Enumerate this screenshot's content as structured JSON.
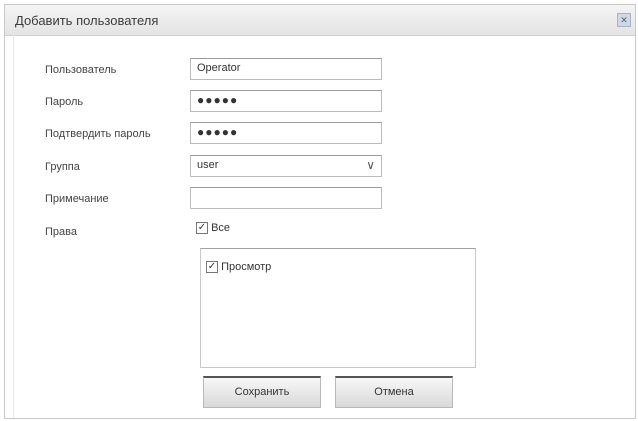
{
  "dialog": {
    "title": "Добавить пользователя",
    "close_glyph": "✕"
  },
  "form": {
    "user_label": "Пользователь",
    "user_value": "Operator",
    "password_label": "Пароль",
    "password_value": "●●●●●",
    "confirm_label": "Подтвердить пароль",
    "confirm_value": "●●●●●",
    "group_label": "Группа",
    "group_value": "user",
    "note_label": "Примечание",
    "note_value": "",
    "rights_label": "Права",
    "all_label": "Все",
    "all_checked": true,
    "rights_items": [
      {
        "label": "Просмотр",
        "checked": true
      }
    ]
  },
  "buttons": {
    "save": "Сохранить",
    "cancel": "Отмена"
  }
}
